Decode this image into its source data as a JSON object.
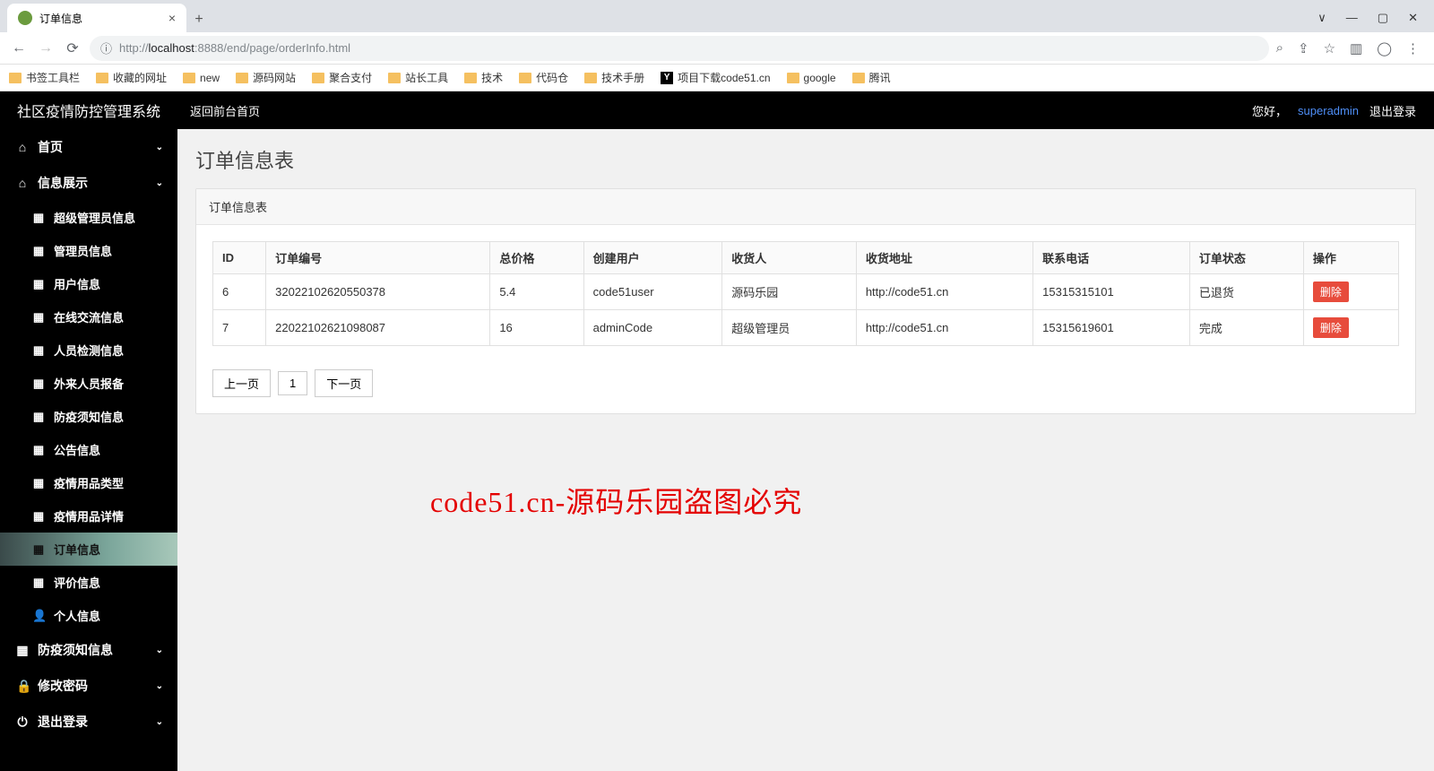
{
  "browser": {
    "tab_title": "订单信息",
    "url_prefix": "http://",
    "url_host": "localhost",
    "url_port": ":8888",
    "url_path": "/end/page/orderInfo.html",
    "bookmarks": [
      {
        "label": "书签工具栏",
        "icon": "folder"
      },
      {
        "label": "收藏的网址",
        "icon": "folder"
      },
      {
        "label": "new",
        "icon": "folder"
      },
      {
        "label": "源码网站",
        "icon": "folder"
      },
      {
        "label": "聚合支付",
        "icon": "folder"
      },
      {
        "label": "站长工具",
        "icon": "folder"
      },
      {
        "label": "技术",
        "icon": "folder"
      },
      {
        "label": "代码仓",
        "icon": "folder"
      },
      {
        "label": "技术手册",
        "icon": "folder"
      },
      {
        "label": "项目下载code51.cn",
        "icon": "y"
      },
      {
        "label": "google",
        "icon": "folder"
      },
      {
        "label": "腾讯",
        "icon": "folder"
      }
    ]
  },
  "header": {
    "brand": "社区疫情防控管理系统",
    "back_link": "返回前台首页",
    "greeting": "您好，",
    "user": "superadmin",
    "logout": "退出登录"
  },
  "sidebar": {
    "home": "首页",
    "info": "信息展示",
    "subs": [
      "超级管理员信息",
      "管理员信息",
      "用户信息",
      "在线交流信息",
      "人员检测信息",
      "外来人员报备",
      "防疫须知信息",
      "公告信息",
      "疫情用品类型",
      "疫情用品详情",
      "订单信息",
      "评价信息",
      "个人信息"
    ],
    "group_notice": "防疫须知信息",
    "group_pwd": "修改密码",
    "group_logout": "退出登录"
  },
  "page": {
    "title": "订单信息表",
    "panel_title": "订单信息表",
    "columns": [
      "ID",
      "订单编号",
      "总价格",
      "创建用户",
      "收货人",
      "收货地址",
      "联系电话",
      "订单状态",
      "操作"
    ],
    "rows": [
      {
        "id": "6",
        "no": "32022102620550378",
        "price": "5.4",
        "creator": "code51user",
        "receiver": "源码乐园",
        "addr": "http://code51.cn",
        "phone": "15315315101",
        "status": "已退货",
        "op": "删除"
      },
      {
        "id": "7",
        "no": "22022102621098087",
        "price": "16",
        "creator": "adminCode",
        "receiver": "超级管理员",
        "addr": "http://code51.cn",
        "phone": "15315619601",
        "status": "完成",
        "op": "删除"
      }
    ],
    "pager": {
      "prev": "上一页",
      "page": "1",
      "next": "下一页"
    },
    "watermark": "code51.cn-源码乐园盗图必究"
  }
}
